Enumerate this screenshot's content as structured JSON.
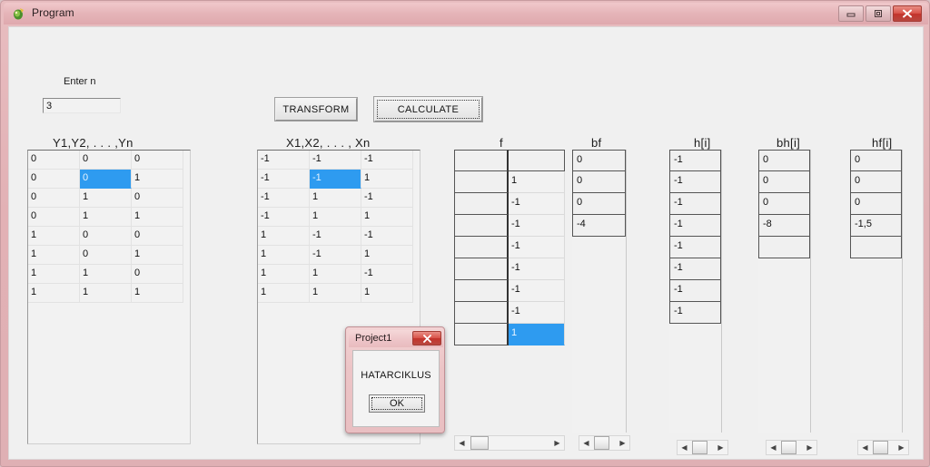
{
  "window": {
    "title": "Program",
    "icon": "app-icon",
    "buttons": {
      "minimize": "–",
      "maximize": "▣",
      "close": "✕"
    },
    "frame_color": "#e2b1b5"
  },
  "form": {
    "enter_n_label": "Enter n",
    "enter_n_value": "3",
    "enter_n_placeholder": "",
    "transform_label": "TRANSFORM",
    "calculate_label": "CALCULATE"
  },
  "panels": {
    "y_label": "Y1,Y2, . . . ,Yn",
    "x_label": "X1,X2, . . . , Xn",
    "f_label": "f",
    "bf_label": "bf",
    "h_label": "h[i]",
    "bh_label": "bh[i]",
    "hf_label": "hf[i]"
  },
  "grids": {
    "y": {
      "columns": 3,
      "rows": [
        [
          "0",
          "0",
          "0"
        ],
        [
          "0",
          "0",
          "1"
        ],
        [
          "0",
          "1",
          "0"
        ],
        [
          "0",
          "1",
          "1"
        ],
        [
          "1",
          "0",
          "0"
        ],
        [
          "1",
          "0",
          "1"
        ],
        [
          "1",
          "1",
          "0"
        ],
        [
          "1",
          "1",
          "1"
        ]
      ],
      "selected": {
        "row": 1,
        "col": 1
      }
    },
    "x": {
      "columns": 3,
      "rows": [
        [
          "-1",
          "-1",
          "-1"
        ],
        [
          "-1",
          "-1",
          "1"
        ],
        [
          "-1",
          "1",
          "-1"
        ],
        [
          "-1",
          "1",
          "1"
        ],
        [
          "1",
          "-1",
          "-1"
        ],
        [
          "1",
          "-1",
          "1"
        ],
        [
          "1",
          "1",
          "-1"
        ],
        [
          "1",
          "1",
          "1"
        ]
      ],
      "selected": {
        "row": 1,
        "col": 1
      }
    },
    "f": {
      "rows": [
        "",
        "1",
        "-1",
        "-1",
        "-1",
        "-1",
        "-1",
        "-1",
        "1"
      ],
      "selected_row": 8
    },
    "bf": {
      "rows": [
        "0",
        "0",
        "0",
        "-4"
      ]
    },
    "h": {
      "rows": [
        "-1",
        "-1",
        "-1",
        "-1",
        "-1",
        "-1",
        "-1",
        "-1"
      ]
    },
    "bh": {
      "rows": [
        "0",
        "0",
        "0",
        "-8",
        ""
      ]
    },
    "hf": {
      "rows": [
        "0",
        "0",
        "0",
        "-1,5",
        ""
      ]
    }
  },
  "scrollbars": {
    "left_arrow": "◀",
    "right_arrow": "▶"
  },
  "dialog": {
    "title": "Project1",
    "close_label": "✕",
    "message": "HATARCIKLUS",
    "ok_label": "OK"
  }
}
